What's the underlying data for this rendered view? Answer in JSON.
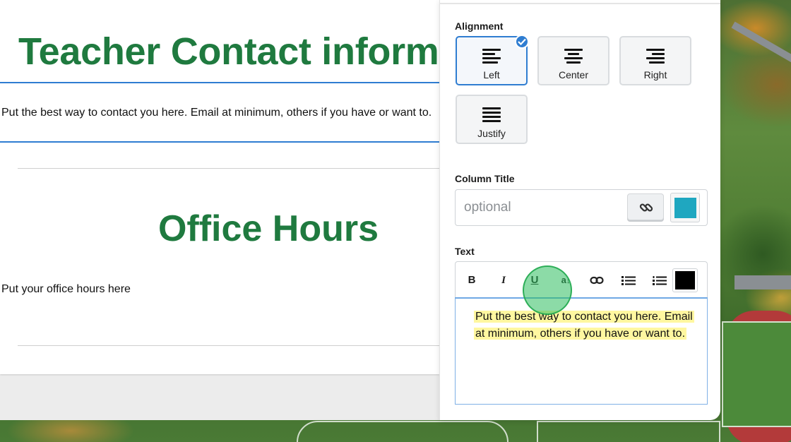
{
  "page": {
    "heading_contact": "Teacher Contact information",
    "selected_paragraph": "Put the best way to contact you here.  Email at minimum, others if you have or want to.",
    "heading_office": "Office Hours",
    "office_paragraph": "Put your office hours here"
  },
  "panel": {
    "alignment_label": "Alignment",
    "alignment_options": [
      {
        "label": "Left",
        "icon": "align-left-icon",
        "selected": true
      },
      {
        "label": "Center",
        "icon": "align-center-icon",
        "selected": false
      },
      {
        "label": "Right",
        "icon": "align-right-icon",
        "selected": false
      },
      {
        "label": "Justify",
        "icon": "align-justify-icon",
        "selected": false
      }
    ],
    "column_title_label": "Column Title",
    "column_title_value": "",
    "column_title_placeholder": "optional",
    "column_title_color": "#1fa7c0",
    "text_label": "Text",
    "toolbar": {
      "bold": "B",
      "italic": "I",
      "underline": "U",
      "font_size": "a",
      "link_icon": "link-icon",
      "bullet_list_icon": "bulleted-list-icon",
      "numbered_list_icon": "numbered-list-icon",
      "text_color": "#000000"
    },
    "text_value": "Put the best way to contact you here.  Email at minimum, others if you have or want to."
  },
  "colors": {
    "heading_green": "#1f7a3f",
    "accent_blue": "#2f7dd1",
    "highlight_yellow": "#fff7a0",
    "click_indicator_green": "#2ebe5e"
  }
}
